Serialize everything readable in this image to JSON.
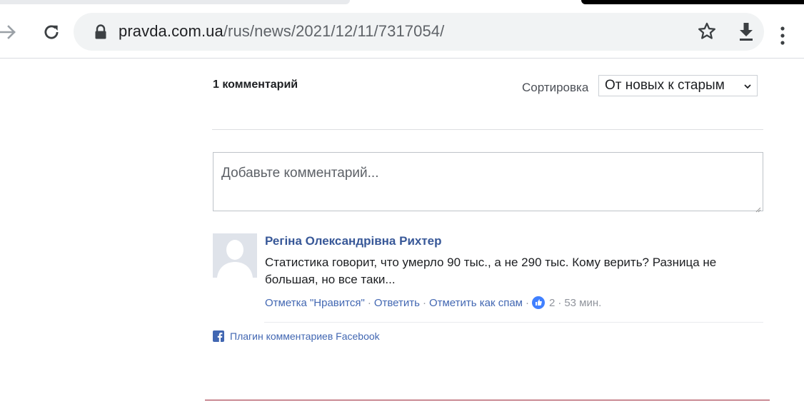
{
  "browser": {
    "url_host": "pravda.com.ua",
    "url_path": "/rus/news/2021/12/11/7317054/"
  },
  "comments": {
    "count_label": "1 комментарий",
    "sort_label": "Сортировка",
    "sort_selected": "От новых к старым",
    "composer_placeholder": "Добавьте комментарий...",
    "items": [
      {
        "author": "Регіна Олександрівна Рихтер",
        "text": "Статистика говорит, что умерло 90 тыс., а не 290 тыс. Кому верить? Разница не большая, но все таки...",
        "like_action": "Отметка \"Нравится\"",
        "reply_action": "Ответить",
        "spam_action": "Отметить как спам",
        "likes": "2",
        "time": "53 мин."
      }
    ],
    "plugin_label": "Плагин комментариев Facebook"
  },
  "colors": {
    "link": "#4267b2",
    "author": "#385898",
    "like_badge": "#4080ff",
    "accent_rule": "#9b2335"
  }
}
